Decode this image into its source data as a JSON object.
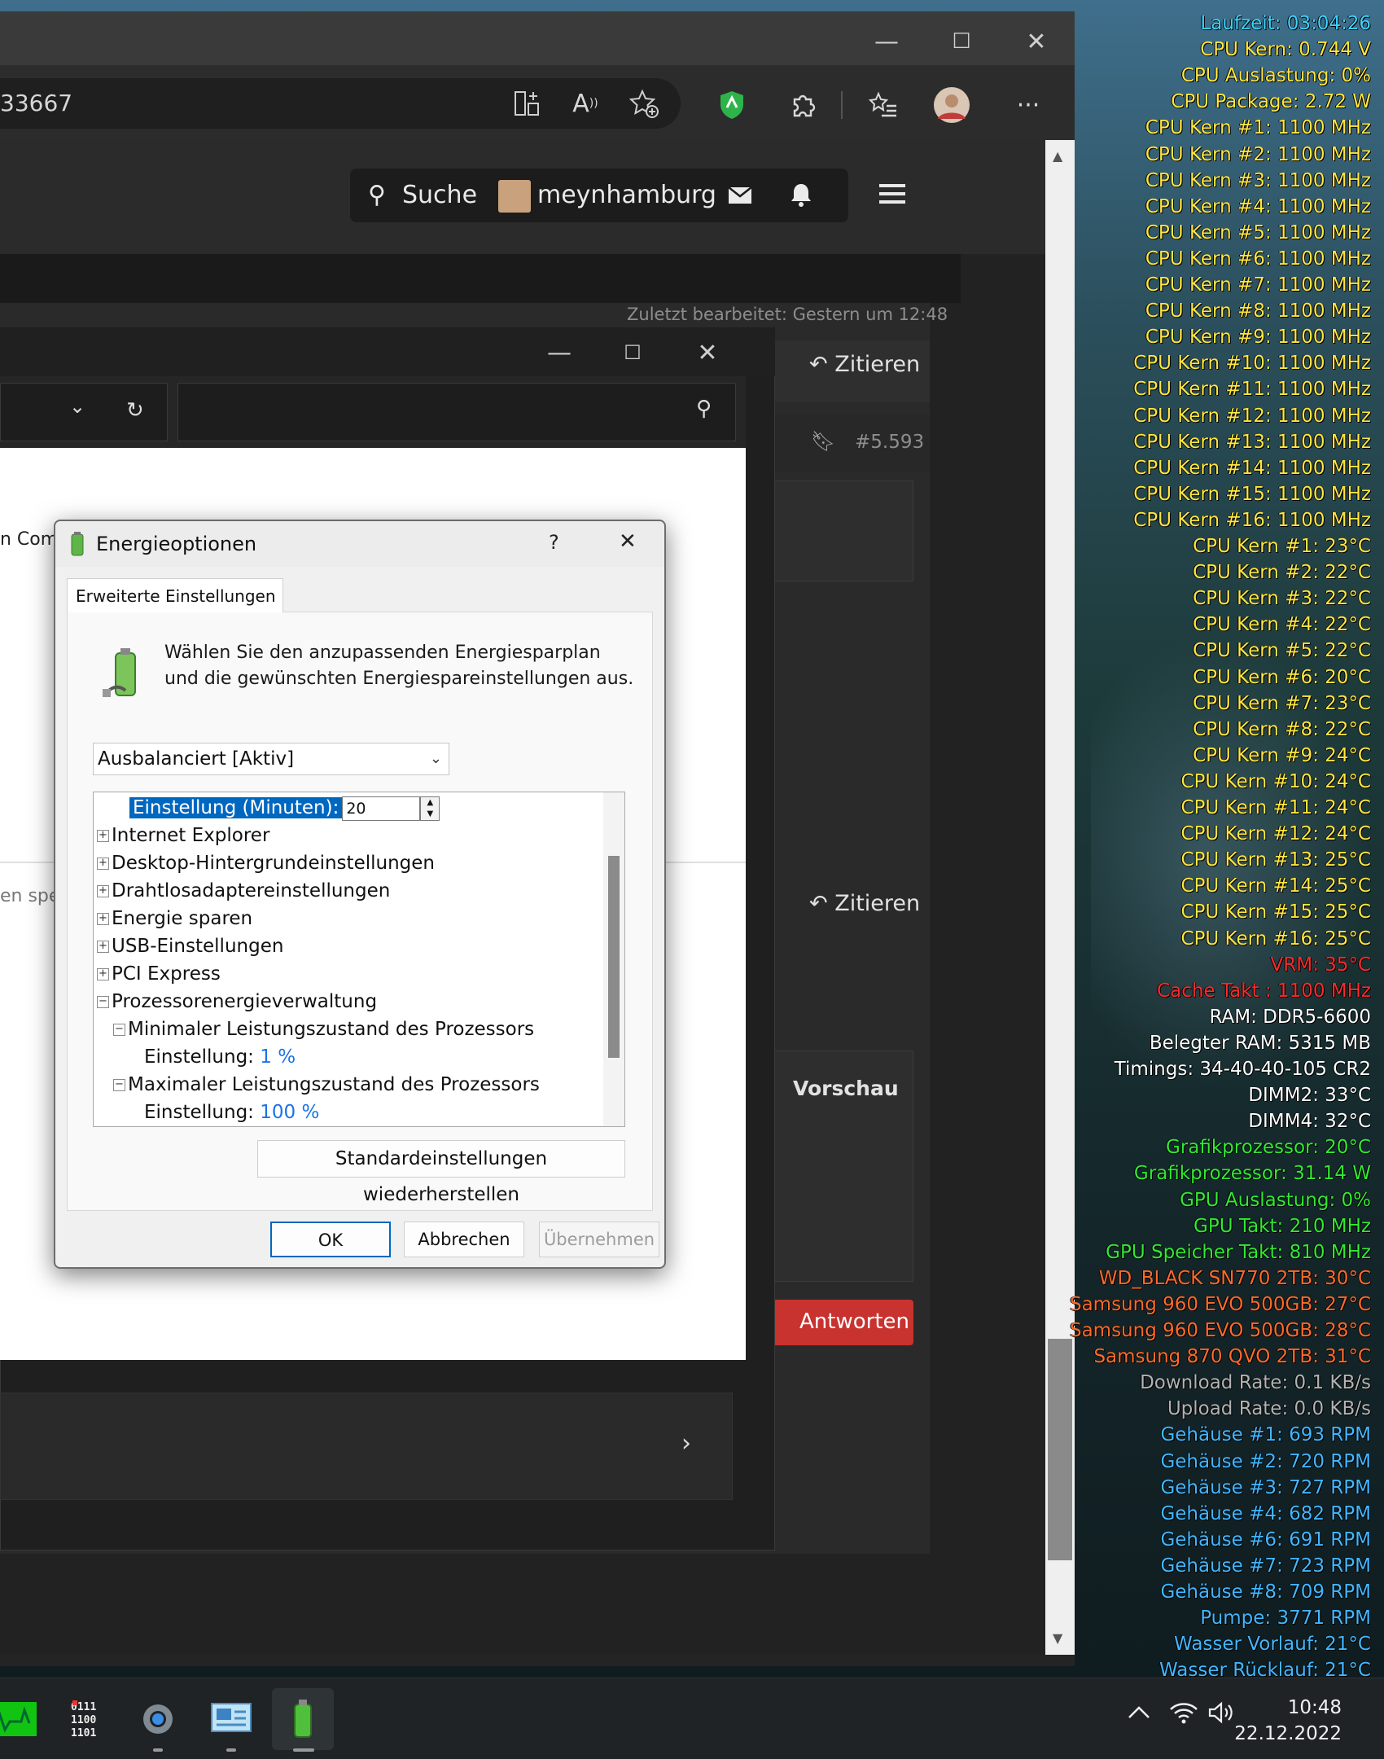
{
  "browser": {
    "address_text": "33667",
    "window_controls": {
      "minimize": "—",
      "maximize": "☐",
      "close": "✕"
    }
  },
  "site": {
    "search_label": "Suche",
    "username": "meynhamburg",
    "last_edited": "Zuletzt bearbeitet: Gestern um 12:48",
    "quote_label": "Zitieren",
    "post_number": "#5.593",
    "preview_label": "Vorschau",
    "reply_label": "Antworten",
    "partial_left_1": "n Com",
    "partial_left_2": "en spe"
  },
  "dialog": {
    "title": "Energieoptionen",
    "help": "?",
    "close": "✕",
    "tab_label": "Erweiterte Einstellungen",
    "description": "Wählen Sie den anzupassenden Energiesparplan und die gewünschten Energiespareinstellungen aus.",
    "plan_selected": "Ausbalanciert [Aktiv]",
    "edit_label": "Einstellung (Minuten):",
    "edit_value": "20",
    "tree": [
      {
        "label": "Internet Explorer",
        "state": "+"
      },
      {
        "label": "Desktop-Hintergrundeinstellungen",
        "state": "+"
      },
      {
        "label": "Drahtlosadaptereinstellungen",
        "state": "+"
      },
      {
        "label": "Energie sparen",
        "state": "+"
      },
      {
        "label": "USB-Einstellungen",
        "state": "+"
      },
      {
        "label": "PCI Express",
        "state": "+"
      },
      {
        "label": "Prozessorenergieverwaltung",
        "state": "−"
      }
    ],
    "min_state": {
      "label": "Minimaler Leistungszustand des Prozessors",
      "setting_label": "Einstellung:",
      "value": "1 %"
    },
    "max_state": {
      "label": "Maximaler Leistungszustand des Prozessors",
      "setting_label": "Einstellung:",
      "value": "100 %"
    },
    "restore_label": "Standardeinstellungen wiederherstellen",
    "ok_label": "OK",
    "cancel_label": "Abbrechen",
    "apply_label": "Übernehmen"
  },
  "osd": {
    "colors": {
      "cyan": "#3fd3ff",
      "yellow": "#ffe640",
      "red": "#ff2a2a",
      "white": "#ffffff",
      "green": "#33e933",
      "orange": "#ff6a2a",
      "gray": "#b3b3b3",
      "blue": "#44b6ff"
    },
    "lines": [
      {
        "text": "Laufzeit: 03:04:26",
        "color": "cyan"
      },
      {
        "text": "CPU Kern: 0.744 V",
        "color": "yellow"
      },
      {
        "text": "CPU Auslastung: 0%",
        "color": "yellow"
      },
      {
        "text": "CPU Package: 2.72 W",
        "color": "yellow"
      },
      {
        "text": "CPU Kern #1: 1100 MHz",
        "color": "yellow"
      },
      {
        "text": "CPU Kern #2: 1100 MHz",
        "color": "yellow"
      },
      {
        "text": "CPU Kern #3: 1100 MHz",
        "color": "yellow"
      },
      {
        "text": "CPU Kern #4: 1100 MHz",
        "color": "yellow"
      },
      {
        "text": "CPU Kern #5: 1100 MHz",
        "color": "yellow"
      },
      {
        "text": "CPU Kern #6: 1100 MHz",
        "color": "yellow"
      },
      {
        "text": "CPU Kern #7: 1100 MHz",
        "color": "yellow"
      },
      {
        "text": "CPU Kern #8: 1100 MHz",
        "color": "yellow"
      },
      {
        "text": "CPU Kern #9: 1100 MHz",
        "color": "yellow"
      },
      {
        "text": "CPU Kern #10: 1100 MHz",
        "color": "yellow"
      },
      {
        "text": "CPU Kern #11: 1100 MHz",
        "color": "yellow"
      },
      {
        "text": "CPU Kern #12: 1100 MHz",
        "color": "yellow"
      },
      {
        "text": "CPU Kern #13: 1100 MHz",
        "color": "yellow"
      },
      {
        "text": "CPU Kern #14: 1100 MHz",
        "color": "yellow"
      },
      {
        "text": "CPU Kern #15: 1100 MHz",
        "color": "yellow"
      },
      {
        "text": "CPU Kern #16: 1100 MHz",
        "color": "yellow"
      },
      {
        "text": "CPU Kern #1: 23°C",
        "color": "yellow"
      },
      {
        "text": "CPU Kern #2: 22°C",
        "color": "yellow"
      },
      {
        "text": "CPU Kern #3: 22°C",
        "color": "yellow"
      },
      {
        "text": "CPU Kern #4: 22°C",
        "color": "yellow"
      },
      {
        "text": "CPU Kern #5: 22°C",
        "color": "yellow"
      },
      {
        "text": "CPU Kern #6: 20°C",
        "color": "yellow"
      },
      {
        "text": "CPU Kern #7: 23°C",
        "color": "yellow"
      },
      {
        "text": "CPU Kern #8: 22°C",
        "color": "yellow"
      },
      {
        "text": "CPU Kern #9: 24°C",
        "color": "yellow"
      },
      {
        "text": "CPU Kern #10: 24°C",
        "color": "yellow"
      },
      {
        "text": "CPU Kern #11: 24°C",
        "color": "yellow"
      },
      {
        "text": "CPU Kern #12: 24°C",
        "color": "yellow"
      },
      {
        "text": "CPU Kern #13: 25°C",
        "color": "yellow"
      },
      {
        "text": "CPU Kern #14: 25°C",
        "color": "yellow"
      },
      {
        "text": "CPU Kern #15: 25°C",
        "color": "yellow"
      },
      {
        "text": "CPU Kern #16: 25°C",
        "color": "yellow"
      },
      {
        "text": "VRM: 35°C",
        "color": "red"
      },
      {
        "text": "Cache Takt : 1100 MHz",
        "color": "red"
      },
      {
        "text": "RAM: DDR5-6600",
        "color": "white"
      },
      {
        "text": "Belegter RAM: 5315 MB",
        "color": "white"
      },
      {
        "text": "Timings: 34-40-40-105 CR2",
        "color": "white"
      },
      {
        "text": "DIMM2: 33°C",
        "color": "white"
      },
      {
        "text": "DIMM4: 32°C",
        "color": "white"
      },
      {
        "text": "Grafikprozessor: 20°C",
        "color": "green"
      },
      {
        "text": "Grafikprozessor: 31.14 W",
        "color": "green"
      },
      {
        "text": "GPU Auslastung: 0%",
        "color": "green"
      },
      {
        "text": "GPU Takt: 210 MHz",
        "color": "green"
      },
      {
        "text": "GPU Speicher Takt: 810 MHz",
        "color": "green"
      },
      {
        "text": "WD_BLACK SN770 2TB: 30°C",
        "color": "orange"
      },
      {
        "text": "Samsung 960 EVO 500GB: 27°C",
        "color": "orange"
      },
      {
        "text": "Samsung 960 EVO 500GB: 28°C",
        "color": "orange"
      },
      {
        "text": "Samsung 870 QVO 2TB: 31°C",
        "color": "orange"
      },
      {
        "text": "Download Rate: 0.1 KB/s",
        "color": "gray"
      },
      {
        "text": "Upload Rate: 0.0 KB/s",
        "color": "gray"
      },
      {
        "text": "Gehäuse #1: 693 RPM",
        "color": "blue"
      },
      {
        "text": "Gehäuse #2: 720 RPM",
        "color": "blue"
      },
      {
        "text": "Gehäuse #3: 727 RPM",
        "color": "blue"
      },
      {
        "text": "Gehäuse #4: 682 RPM",
        "color": "blue"
      },
      {
        "text": "Gehäuse #6: 691 RPM",
        "color": "blue"
      },
      {
        "text": "Gehäuse #7: 723 RPM",
        "color": "blue"
      },
      {
        "text": "Gehäuse #8: 709 RPM",
        "color": "blue"
      },
      {
        "text": "Pumpe: 3771 RPM",
        "color": "blue"
      },
      {
        "text": "Wasser Vorlauf: 21°C",
        "color": "blue"
      },
      {
        "text": "Wasser Rücklauf: 21°C",
        "color": "blue"
      }
    ]
  },
  "taskbar": {
    "time": "10:48",
    "date": "22.12.2022",
    "apps": [
      "hwinfo-graph-icon",
      "hwinfo-sensors-icon",
      "settings-gear-icon",
      "control-panel-icon",
      "power-options-icon"
    ],
    "tray_icons": [
      "chevron-up-icon",
      "wifi-icon",
      "volume-icon"
    ]
  }
}
